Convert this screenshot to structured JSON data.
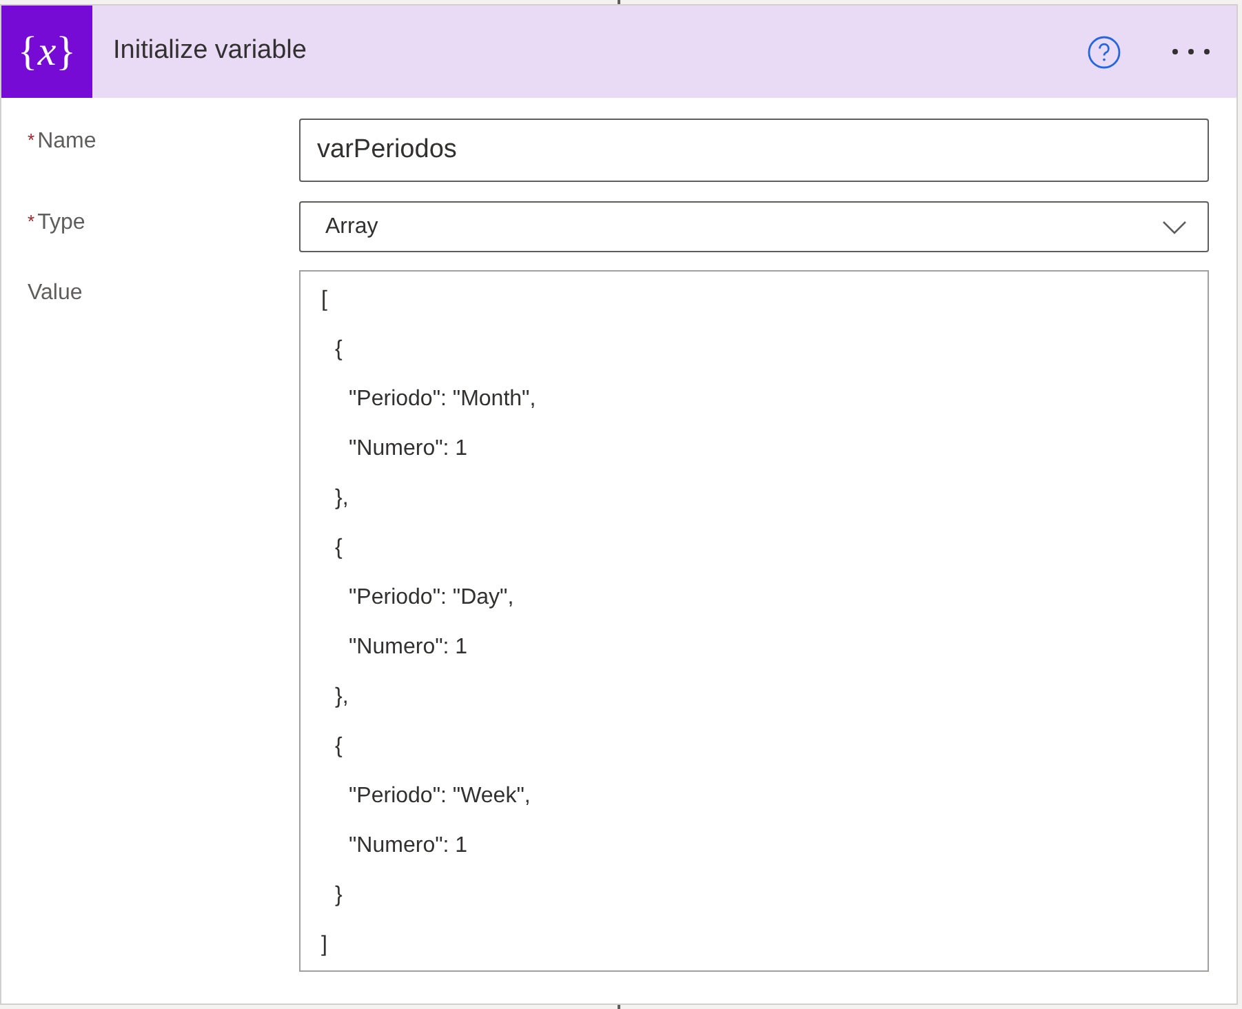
{
  "card": {
    "icon_text": "{*x*}",
    "title": "Initialize variable"
  },
  "fields": [
    {
      "kind": "text",
      "required_mark": "*",
      "label": "Name",
      "value": "varPeriodos"
    },
    {
      "kind": "dropdown",
      "required_mark": "*",
      "label": "Type",
      "value": "Array"
    },
    {
      "kind": "code",
      "label": "Value",
      "lines": [
        {
          "text": "[",
          "children": [
            {
              "text": "{",
              "children": [
                {
                  "text": "\"Periodo\": \"Month\","
                },
                {
                  "text": "\"Numero\": 1"
                }
              ]
            },
            {
              "text": "},"
            },
            {
              "text": "{",
              "children": [
                {
                  "text": "\"Periodo\": \"Day\","
                },
                {
                  "text": "\"Numero\": 1"
                }
              ]
            },
            {
              "text": "},"
            },
            {
              "text": "{",
              "children": [
                {
                  "text": "\"Periodo\": \"Week\","
                },
                {
                  "text": "\"Numero\": 1"
                }
              ]
            },
            {
              "text": "}"
            }
          ]
        },
        {
          "text": "]"
        }
      ]
    }
  ]
}
